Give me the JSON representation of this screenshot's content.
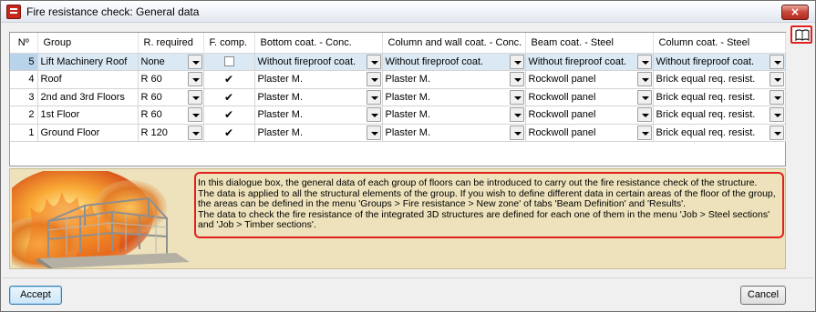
{
  "window": {
    "title": "Fire resistance check: General data",
    "close_glyph": "×"
  },
  "columns": [
    "Nº",
    "Group",
    "R. required",
    "F. comp.",
    "Bottom coat. - Conc.",
    "Column and wall coat. - Conc.",
    "Beam coat. - Steel",
    "Column coat. - Steel"
  ],
  "rows": [
    {
      "num": "5",
      "group": "Lift Machinery Roof",
      "r_required": "None",
      "f_comp": false,
      "bottom_coat": "Without fireproof coat.",
      "column_wall_coat": "Without fireproof coat.",
      "beam_coat": "Without fireproof coat.",
      "column_coat": "Without fireproof coat.",
      "selected": true
    },
    {
      "num": "4",
      "group": "Roof",
      "r_required": "R 60",
      "f_comp": true,
      "bottom_coat": "Plaster M.",
      "column_wall_coat": "Plaster M.",
      "beam_coat": "Rockwoll panel",
      "column_coat": "Brick equal req. resist.",
      "selected": false
    },
    {
      "num": "3",
      "group": "2nd and 3rd Floors",
      "r_required": "R 60",
      "f_comp": true,
      "bottom_coat": "Plaster M.",
      "column_wall_coat": "Plaster M.",
      "beam_coat": "Rockwoll panel",
      "column_coat": "Brick equal req. resist.",
      "selected": false
    },
    {
      "num": "2",
      "group": "1st Floor",
      "r_required": "R 60",
      "f_comp": true,
      "bottom_coat": "Plaster M.",
      "column_wall_coat": "Plaster M.",
      "beam_coat": "Rockwoll panel",
      "column_coat": "Brick equal req. resist.",
      "selected": false
    },
    {
      "num": "1",
      "group": "Ground Floor",
      "r_required": "R 120",
      "f_comp": true,
      "bottom_coat": "Plaster M.",
      "column_wall_coat": "Plaster M.",
      "beam_coat": "Rockwoll panel",
      "column_coat": "Brick equal req. resist.",
      "selected": false
    }
  ],
  "checkmark_glyph": "✔",
  "help_text": [
    "In this dialogue box, the general data of each group of floors can be introduced to carry out the fire resistance check of the structure.",
    "The data is applied to all the structural elements of the group. If you wish to define different data in certain areas of the floor of the group,",
    "the areas can be defined in the menu 'Groups > Fire resistance > New zone' of tabs 'Beam Definition' and 'Results'.",
    "The data to check the fire resistance of the integrated 3D structures are defined for each one of them in the menu 'Job > Steel sections'",
    "and 'Job > Timber sections'."
  ],
  "buttons": {
    "accept": "Accept",
    "cancel": "Cancel"
  },
  "icons": {
    "app": "fire-app-icon",
    "close": "close-icon",
    "help": "book-help-icon",
    "dropdown": "dropdown-arrow-icon"
  },
  "colors": {
    "help_border": "#e02020",
    "info_background": "#ede2bb",
    "selected_row": "#dbe9f5"
  }
}
